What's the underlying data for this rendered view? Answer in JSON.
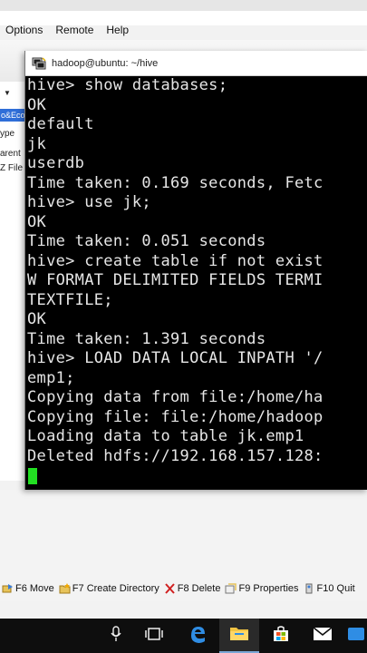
{
  "menubar": {
    "items": [
      "Options",
      "Remote",
      "Help"
    ]
  },
  "left_panel": {
    "chip_text": "o&Eco",
    "lines": [
      "ype",
      "arent",
      "Z File"
    ]
  },
  "window": {
    "title": "hadoop@ubuntu: ~/hive"
  },
  "terminal": {
    "lines": [
      "hive> show databases;",
      "OK",
      "default",
      "jk",
      "userdb",
      "Time taken: 0.169 seconds, Fetc",
      "hive> use jk;",
      "OK",
      "Time taken: 0.051 seconds",
      "hive> create table if not exist",
      "W FORMAT DELIMITED FIELDS TERMI",
      "TEXTFILE;",
      "OK",
      "Time taken: 1.391 seconds",
      "hive> LOAD DATA LOCAL INPATH '/",
      "emp1;",
      "Copying data from file:/home/ha",
      "Copying file: file:/home/hadoop",
      "Loading data to table jk.emp1",
      "Deleted hdfs://192.168.157.128:"
    ],
    "cursor_color": "#22e022"
  },
  "fkeys": [
    {
      "label": "F6 Move",
      "icon": "move-icon"
    },
    {
      "label": "F7 Create Directory",
      "icon": "folder-icon"
    },
    {
      "label": "F8 Delete",
      "icon": "delete-icon"
    },
    {
      "label": "F9 Properties",
      "icon": "properties-icon"
    },
    {
      "label": "F10 Quit",
      "icon": "quit-icon"
    }
  ],
  "taskbar": {
    "icons": [
      "microphone-icon",
      "task-view-icon",
      "edge-icon",
      "file-explorer-icon",
      "store-icon",
      "mail-icon",
      "app-icon"
    ]
  }
}
